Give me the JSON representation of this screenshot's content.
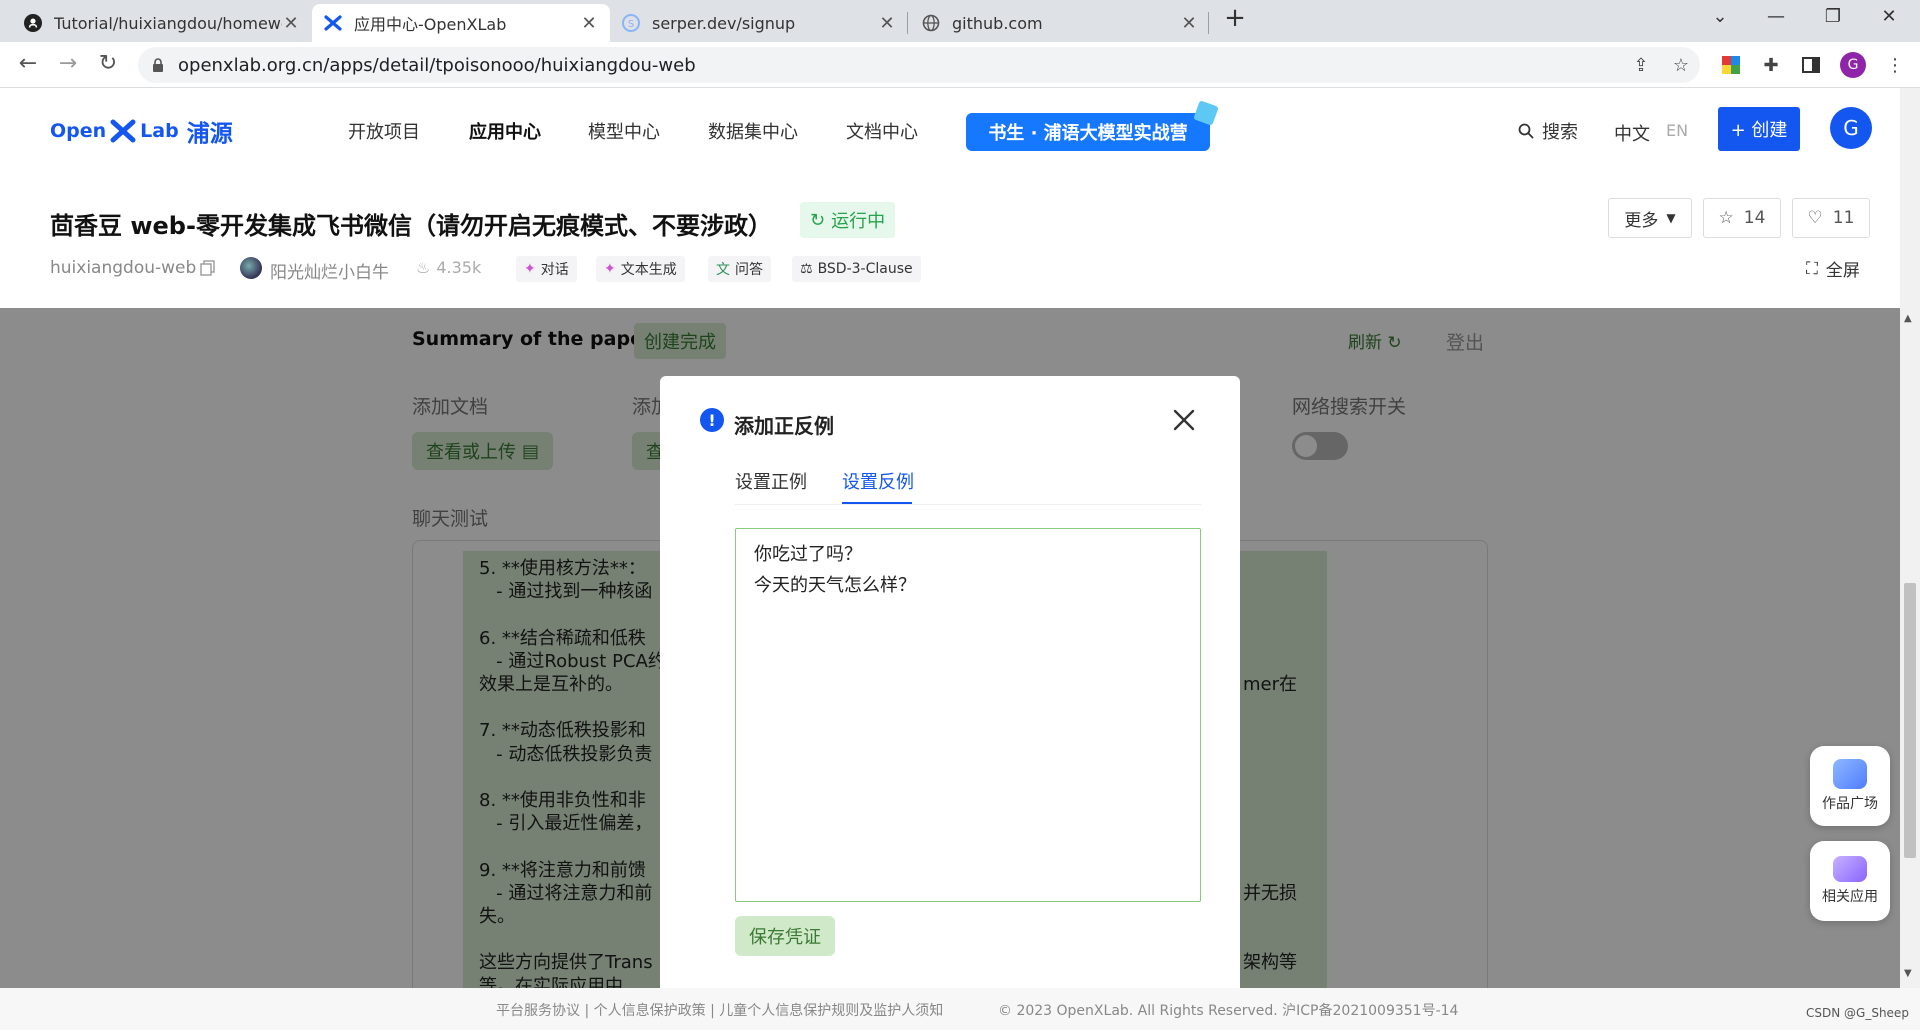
{
  "browser": {
    "tabs": [
      {
        "title": "Tutorial/huixiangdou/homewo",
        "icon": "github-icon",
        "active": false
      },
      {
        "title": "应用中心-OpenXLab",
        "icon": "openxlab-icon",
        "active": true
      },
      {
        "title": "serper.dev/signup",
        "icon": "serper-icon",
        "active": false
      },
      {
        "title": "github.com",
        "icon": "globe-icon",
        "active": false
      }
    ],
    "url": "openxlab.org.cn/apps/detail/tpoisonooo/huixiangdou-web",
    "profile_initial": "G"
  },
  "site": {
    "logo_text": "Open",
    "logo_lab": "Lab",
    "logo_cn": "浦源",
    "nav": [
      "开放项目",
      "应用中心",
      "模型中心",
      "数据集中心",
      "文档中心"
    ],
    "banner": "书生 · 浦语大模型实战营",
    "search_label": "搜索",
    "lang_zh": "中文",
    "lang_en": "EN",
    "create_label": "+ 创建",
    "avatar_initial": "G"
  },
  "app": {
    "title": "茴香豆 web-零开发集成飞书微信（请勿开启无痕模式、不要涉政）",
    "status": "运行中",
    "repo_name": "huixiangdou-web",
    "author": "阳光灿烂小白牛",
    "views": "4.35k",
    "tags": [
      "对话",
      "文本生成",
      "问答",
      "BSD-3-Clause"
    ],
    "more_label": "更多",
    "stars": "14",
    "likes": "11",
    "fullscreen_label": "全屏"
  },
  "workspace": {
    "summary_title": "Summary of the paper",
    "summary_status": "创建完成",
    "refresh_label": "刷新",
    "logout_label": "登出",
    "add_doc_label": "添加文档",
    "add_doc_button": "查看或上传",
    "add_example_label": "添加",
    "add_example_button": "查",
    "web_search_label": "网络搜索开关",
    "chat_test_label": "聊天测试",
    "chat_lines_left": [
      "5. **使用核方法**：",
      "   - 通过找到一种核函",
      "",
      "6. **结合稀疏和低秩",
      "   - 通过Robust PCA约",
      "效果上是互补的。",
      "",
      "7. **动态低秩投影和",
      "   - 动态低秩投影负责",
      "",
      "8. **使用非负性和非",
      "   - 引入最近性偏差，",
      "",
      "9. **将注意力和前馈",
      "   - 通过将注意力和前",
      "失。",
      "",
      "这些方向提供了Trans",
      "等。在实际应用中，"
    ],
    "chat_lines_right": [
      {
        "row": 5,
        "text": "mer在"
      },
      {
        "row": 14,
        "text": "并无损"
      },
      {
        "row": 17,
        "text": "架构等"
      }
    ]
  },
  "modal": {
    "title": "添加正反例",
    "tabs": [
      "设置正例",
      "设置反例"
    ],
    "active_tab": 1,
    "textarea_value": "你吃过了吗？\n今天的天气怎么样？",
    "save_label": "保存凭证"
  },
  "footer": {
    "links": "平台服务协议 | 个人信息保护政策 | 儿童个人信息保护规则及监护人须知",
    "copyright": "© 2023 OpenXLab. All Rights Reserved. 沪ICP备2021009351号-14",
    "watermark": "CSDN @G_Sheep"
  },
  "floating": [
    {
      "label": "作品广场",
      "icon": "gallery-icon"
    },
    {
      "label": "相关应用",
      "icon": "related-apps-icon"
    }
  ],
  "colors": {
    "primary": "#1456f0",
    "green": "#3a7a35",
    "green_bg": "#d7ecd4",
    "running_bg": "#e6f7ec",
    "chat_bg": "#d7ecd4"
  }
}
